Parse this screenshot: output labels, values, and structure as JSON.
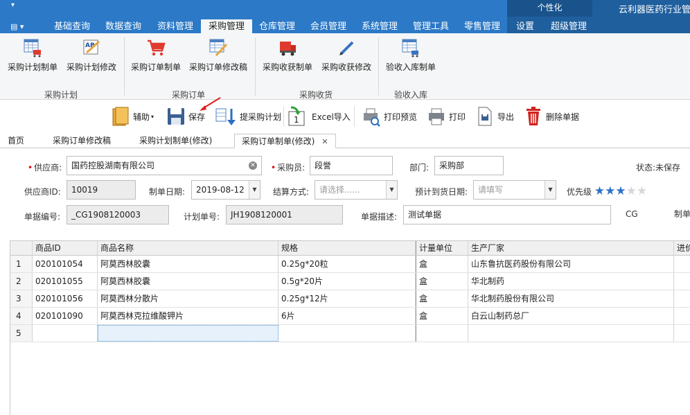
{
  "app": {
    "title": "云利器医药行业管",
    "personalize": "个性化",
    "menu_tabs": [
      "基础查询",
      "数据查询",
      "资料管理",
      "采购管理",
      "仓库管理",
      "会员管理",
      "系统管理",
      "管理工具",
      "零售管理",
      "设置",
      "超级管理"
    ],
    "active_tab": "采购管理"
  },
  "ribbon": {
    "buttons": [
      "采购计划制单",
      "采购计划修改",
      "采购订单制单",
      "采购订单修改稿",
      "采购收获制单",
      "采购收获修改",
      "验收入库制单"
    ],
    "groups": [
      "采购计划",
      "采购订单",
      "采购收货",
      "验收入库"
    ]
  },
  "toolbar": {
    "assist": "辅助",
    "save": "保存",
    "extract_plan": "提采购计划",
    "excel_import": "Excel导入",
    "print_preview": "打印预览",
    "print": "打印",
    "export": "导出",
    "delete": "删除单据"
  },
  "doc_tabs": [
    "首页",
    "采购订单修改稿",
    "采购计划制单(修改)",
    "采购订单制单(修改)"
  ],
  "form": {
    "supplier_label": "供应商:",
    "supplier_value": "国药控股湖南有限公司",
    "buyer_label": "采购员:",
    "buyer_value": "段誉",
    "dept_label": "部门:",
    "dept_value": "采购部",
    "status_label": "状态:",
    "status_value": "未保存",
    "supplier_id_label": "供应商ID:",
    "supplier_id_value": "10019",
    "make_date_label": "制单日期:",
    "make_date_value": "2019-08-12",
    "settle_label": "结算方式:",
    "settle_placeholder": "请选择......",
    "arrival_label": "预计到货日期:",
    "arrival_placeholder": "请填写",
    "priority_label": "优先级",
    "priority_stars": 3,
    "priority_max": 5,
    "doc_no_label": "单据编号:",
    "doc_no_value": "_CG1908120003",
    "plan_no_label": "计划单号:",
    "plan_no_value": "JH1908120001",
    "desc_label": "单据描述:",
    "desc_value": "测试单据",
    "cg_text": "CG",
    "maker_label": "制单"
  },
  "grid": {
    "columns": [
      "商品ID",
      "商品名称",
      "规格",
      "计量单位",
      "生产厂家",
      "进价"
    ],
    "rows": [
      [
        "1",
        "020101054",
        "阿莫西林胶囊",
        "0.25g*20粒",
        "盒",
        "山东鲁抗医药股份有限公司",
        ""
      ],
      [
        "2",
        "020101055",
        "阿莫西林胶囊",
        "0.5g*20片",
        "盒",
        "华北制药",
        ""
      ],
      [
        "3",
        "020101056",
        "阿莫西林分散片",
        "0.25g*12片",
        "盒",
        "华北制药股份有限公司",
        ""
      ],
      [
        "4",
        "020101090",
        "阿莫西林克拉维酸钾片",
        "6片",
        "盒",
        "白云山制药总厂",
        ""
      ],
      [
        "5",
        "",
        "",
        "",
        "",
        "",
        ""
      ]
    ]
  },
  "colors": {
    "menu_bg": "#2b79c7",
    "menu_dark": "#1f5f9e",
    "accent_red": "#e03a2f",
    "star": "#2d72c8"
  }
}
